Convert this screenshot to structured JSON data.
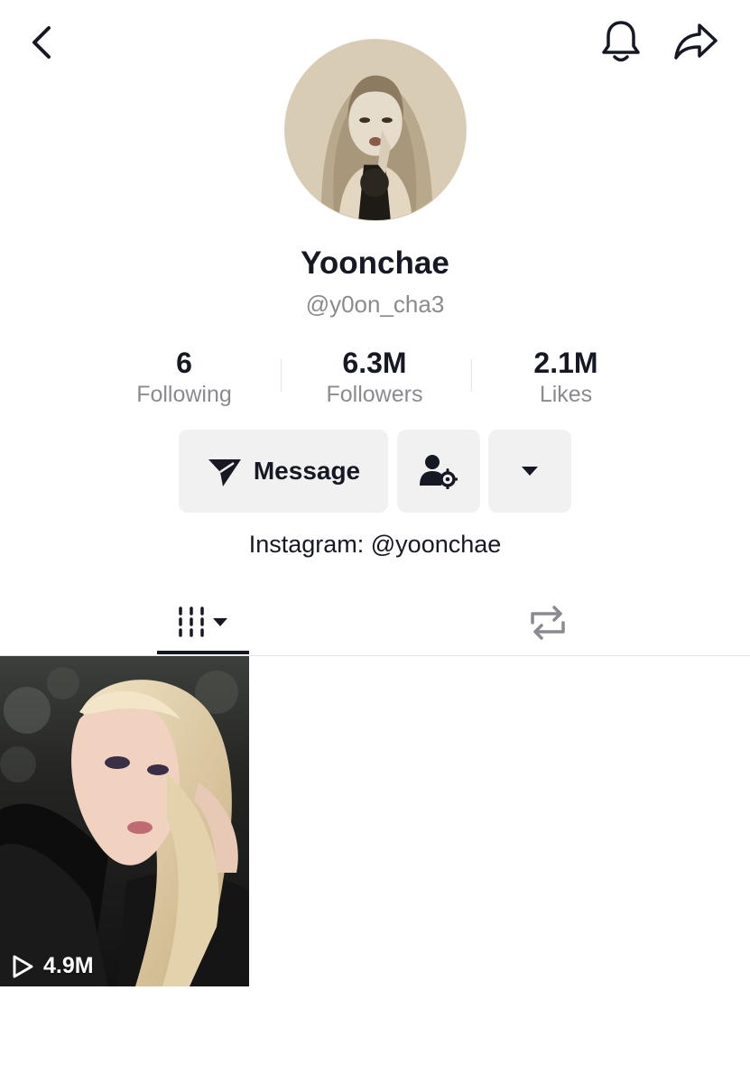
{
  "profile": {
    "display_name": "Yoonchae",
    "handle": "@y0on_cha3",
    "bio": "Instagram: @yoonchae"
  },
  "stats": [
    {
      "value": "6",
      "label": "Following"
    },
    {
      "value": "6.3M",
      "label": "Followers"
    },
    {
      "value": "2.1M",
      "label": "Likes"
    }
  ],
  "actions": {
    "message_label": "Message"
  },
  "icons": {
    "back": "chevron-left-icon",
    "notifications": "bell-icon",
    "share": "share-arrow-icon",
    "message": "paper-plane-icon",
    "friends": "user-settings-icon",
    "more": "caret-down-icon",
    "videos_tab": "grid-bars-icon",
    "reposts_tab": "repost-icon",
    "play": "play-outline-icon"
  },
  "videos": [
    {
      "views": "4.9M"
    }
  ]
}
